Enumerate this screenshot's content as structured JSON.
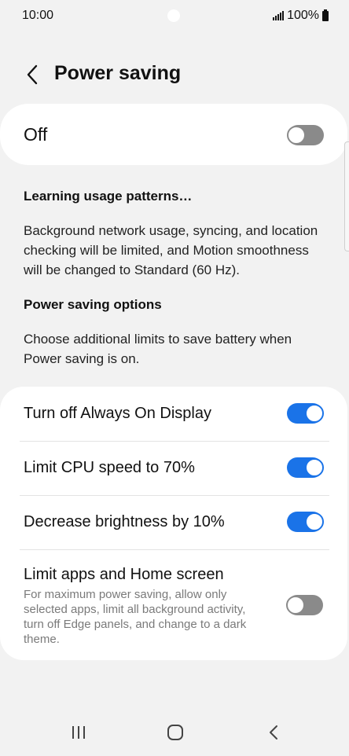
{
  "status_bar": {
    "time": "10:00",
    "battery_text": "100%",
    "signal_icon": "signal-bars-icon",
    "battery_icon": "battery-icon"
  },
  "header": {
    "title": "Power saving",
    "back_icon": "chevron-left-icon"
  },
  "master_switch": {
    "label": "Off",
    "state": "off"
  },
  "learning": {
    "heading": "Learning usage patterns…",
    "body": "Background network usage, syncing, and location checking will be limited, and Motion smoothness will be changed to Standard (60 Hz)."
  },
  "options_section": {
    "heading": "Power saving options",
    "body": "Choose additional limits to save battery when Power saving is on."
  },
  "options": [
    {
      "label": "Turn off Always On Display",
      "state": "on"
    },
    {
      "label": "Limit CPU speed to 70%",
      "state": "on"
    },
    {
      "label": "Decrease brightness by 10%",
      "state": "on"
    },
    {
      "label": "Limit apps and Home screen",
      "description": "For maximum power saving, allow only selected apps, limit all background activity, turn off Edge panels, and change to a dark theme.",
      "state": "off"
    }
  ],
  "colors": {
    "accent": "#1a73e8",
    "toggle_off": "#8a8a8a",
    "background": "#f2f2f2",
    "card": "#ffffff"
  },
  "nav_bar": {
    "recents_icon": "recents-icon",
    "home_icon": "home-icon",
    "back_icon": "nav-back-icon"
  }
}
